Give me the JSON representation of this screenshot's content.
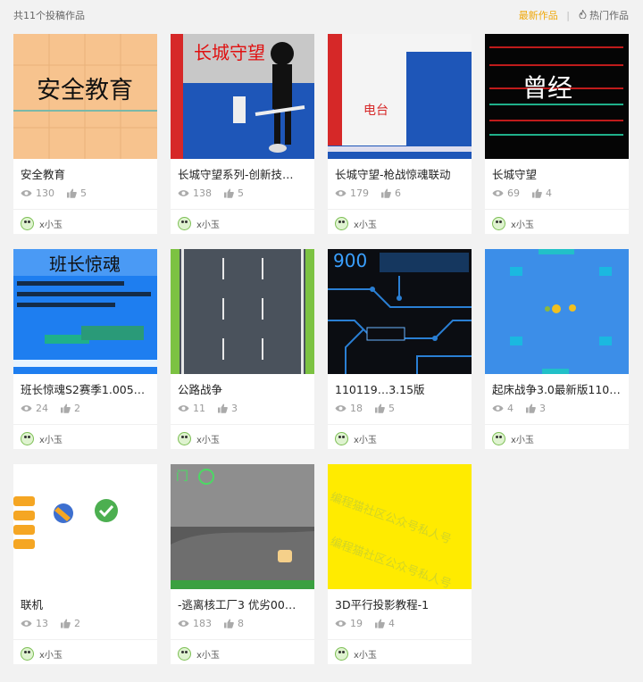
{
  "header": {
    "total_label": "共11个投稿作品",
    "sort_latest": "最新作品",
    "separator": "|",
    "sort_hot": "热门作品"
  },
  "works": [
    {
      "title": "安全教育",
      "views": "130",
      "likes": "5",
      "author": "x小玉",
      "thumb_text": "安全教育"
    },
    {
      "title": "长城守望系列-创新技…",
      "views": "138",
      "likes": "5",
      "author": "x小玉",
      "thumb_text": "长城守望"
    },
    {
      "title": "长城守望-枪战惊魂联动",
      "views": "179",
      "likes": "6",
      "author": "x小玉",
      "thumb_text": "电台"
    },
    {
      "title": "长城守望",
      "views": "69",
      "likes": "4",
      "author": "x小玉",
      "thumb_text": "曾经"
    },
    {
      "title": "班长惊魂S2赛季1.005…",
      "views": "24",
      "likes": "2",
      "author": "x小玉",
      "thumb_text": "班长惊魂"
    },
    {
      "title": "公路战争",
      "views": "11",
      "likes": "3",
      "author": "x小玉",
      "thumb_text": ""
    },
    {
      "title": "110119…3.15版",
      "views": "18",
      "likes": "5",
      "author": "x小玉",
      "thumb_text": "900"
    },
    {
      "title": "起床战争3.0最新版110…",
      "views": "4",
      "likes": "3",
      "author": "x小玉",
      "thumb_text": ""
    },
    {
      "title": "联机",
      "views": "13",
      "likes": "2",
      "author": "x小玉",
      "thumb_text": ""
    },
    {
      "title": "-逃离核工厂3 优劣00…",
      "views": "183",
      "likes": "8",
      "author": "x小玉",
      "thumb_text": "门"
    },
    {
      "title": "3D平行投影教程-1",
      "views": "19",
      "likes": "4",
      "author": "x小玉",
      "thumb_text": "编程猫社区公众号私人号"
    }
  ]
}
